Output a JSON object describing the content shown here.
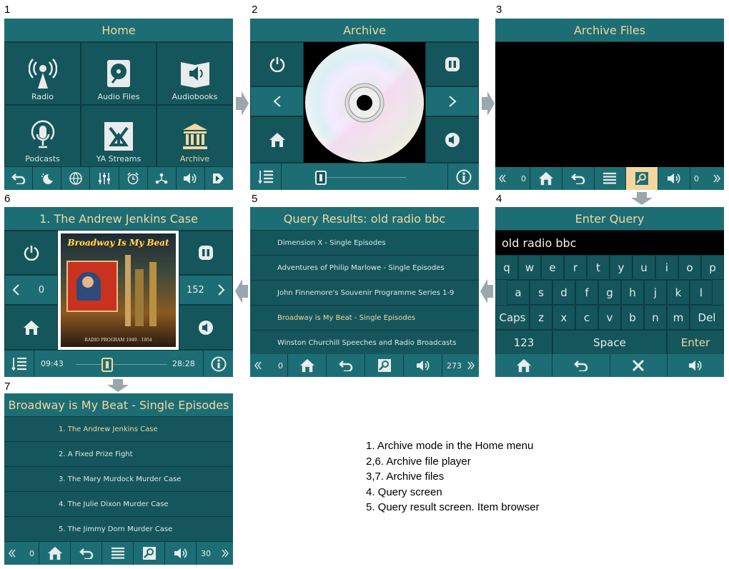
{
  "panel_numbers": {
    "p1": "1",
    "p2": "2",
    "p3": "3",
    "p4": "4",
    "p5": "5",
    "p6": "6",
    "p7": "7"
  },
  "home": {
    "title": "Home",
    "tiles": [
      {
        "label": "Radio",
        "icon": "radio-tower-icon"
      },
      {
        "label": "Audio Files",
        "icon": "hard-drive-icon"
      },
      {
        "label": "Audiobooks",
        "icon": "audiobook-icon"
      },
      {
        "label": "Podcasts",
        "icon": "podcast-icon"
      },
      {
        "label": "YA Streams",
        "icon": "ya-streams-icon"
      },
      {
        "label": "Archive",
        "icon": "archive-icon"
      }
    ]
  },
  "archive": {
    "title": "Archive"
  },
  "archive_files": {
    "title": "Archive Files",
    "left_count": "0",
    "right_count": "0"
  },
  "enter_query": {
    "title": "Enter Query",
    "query": "old radio bbc",
    "row1": [
      "q",
      "w",
      "e",
      "r",
      "t",
      "y",
      "u",
      "i",
      "o",
      "p"
    ],
    "row2": [
      "a",
      "s",
      "d",
      "f",
      "g",
      "h",
      "j",
      "k",
      "l"
    ],
    "row3": [
      "Caps",
      "z",
      "x",
      "c",
      "v",
      "b",
      "n",
      "m",
      "Del"
    ],
    "num_key": "123",
    "space_key": "Space",
    "enter_key": "Enter"
  },
  "query_results": {
    "title": "Query Results: old radio bbc",
    "items": [
      "Dimension X - Single Episodes",
      "Adventures of Philip Marlowe - Single Episodes",
      "John Finnemore's Souvenir Programme Series 1-9",
      "Broadway is My Beat - Single Episodes",
      "Winston Churchill Speeches and Radio Broadcasts"
    ],
    "left_count": "0",
    "right_count": "273"
  },
  "player": {
    "title": "1. The Andrew Jenkins Case",
    "left_value": "0",
    "right_value": "152",
    "elapsed": "09:43",
    "duration": "28:28",
    "progress": 0.34,
    "cover_title": "Broadway Is My Beat",
    "cover_sub": "RADIO PROGRAM   1949 - 1954"
  },
  "episodes": {
    "title": "Broadway is My Beat - Single Episodes",
    "items": [
      "1. The Andrew Jenkins Case",
      "2. A Fixed Prize Fight",
      "3. The Mary Murdock Murder Case",
      "4. The Julie Dixon Murder Case",
      "5. The Jimmy Dorn Murder Case"
    ],
    "left_count": "0",
    "right_count": "30"
  },
  "legend": [
    "1. Archive mode in the Home menu",
    "2,6. Archive file player",
    "3,7. Archive files",
    "4. Query screen",
    "5. Query result screen. Item browser"
  ],
  "colors": {
    "panel": "#14565c",
    "header": "#1d6e74",
    "accent": "#f3d79f"
  }
}
